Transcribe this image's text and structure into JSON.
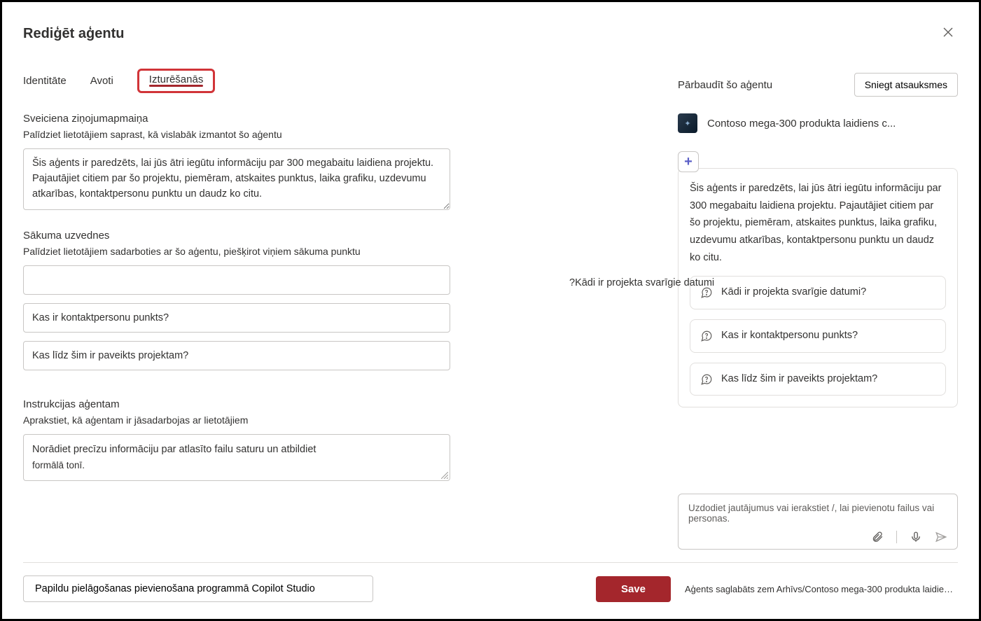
{
  "header": {
    "title": "Rediģēt aģentu"
  },
  "tabs": {
    "identity": "Identitāte",
    "sources": "Avoti",
    "behavior": "Izturēšanās"
  },
  "welcome": {
    "heading": "Sveiciena ziņojumapmaiņa",
    "sub": "Palīdziet lietotājiem saprast, kā vislabāk izmantot šo aģentu",
    "value": "Šis aģents ir paredzēts, lai jūs ātri iegūtu informāciju par 300 megabaitu laidiena projektu. Pajautājiet citiem par šo projektu, piemēram, atskaites punktus, laika grafiku, uzdevumu atkarības, kontaktpersonu punktu un daudz ko citu."
  },
  "starters": {
    "heading": "Sākuma uzvednes",
    "sub": "Palīdziet lietotājiem sadarboties ar šo aģentu, piešķirot viņiem sākuma punktu",
    "items": [
      "",
      "Kas ir kontaktpersonu punkts?",
      "Kas līdz šim ir paveikts projektam?"
    ]
  },
  "instructions": {
    "heading": "Instrukcijas aģentam",
    "sub": "Aprakstiet, kā aģentam ir jāsadarbojas ar lietotājiem",
    "line1": "Norādiet precīzu informāciju par atlasīto failu saturu un atbildiet",
    "line2": "formālā tonī."
  },
  "right": {
    "test_label": "Pārbaudīt šo aģentu",
    "feedback": "Sniegt atsauksmes",
    "agent_name": "Contoso mega-300 produkta laidiens c...",
    "welcome_text": "Šis aģents ir paredzēts, lai jūs ātri iegūtu informāciju par 300 megabaitu laidiena projektu. Pajautājiet citiem par šo projektu, piemēram, atskaites punktus, laika grafiku, uzdevumu atkarības, kontaktpersonu punktu un daudz ko citu.",
    "suggestions": [
      "Kādi ir projekta svarīgie datumi?",
      "Kas ir kontaktpersonu punkts?",
      "Kas līdz šim ir paveikts projektam?"
    ],
    "stray": "?Kādi ir projekta svarīgie datumi",
    "input_placeholder": "Uzdodiet jautājumus vai ierakstiet /, lai pievienotu failus vai personas."
  },
  "footer": {
    "copilot_studio": "Papildu pielāgošanas pievienošana programmā Copilot Studio",
    "save": "Save",
    "note": "Aģents saglabāts zem Arhīvs/Contoso mega-300 produkta laidiens..."
  }
}
